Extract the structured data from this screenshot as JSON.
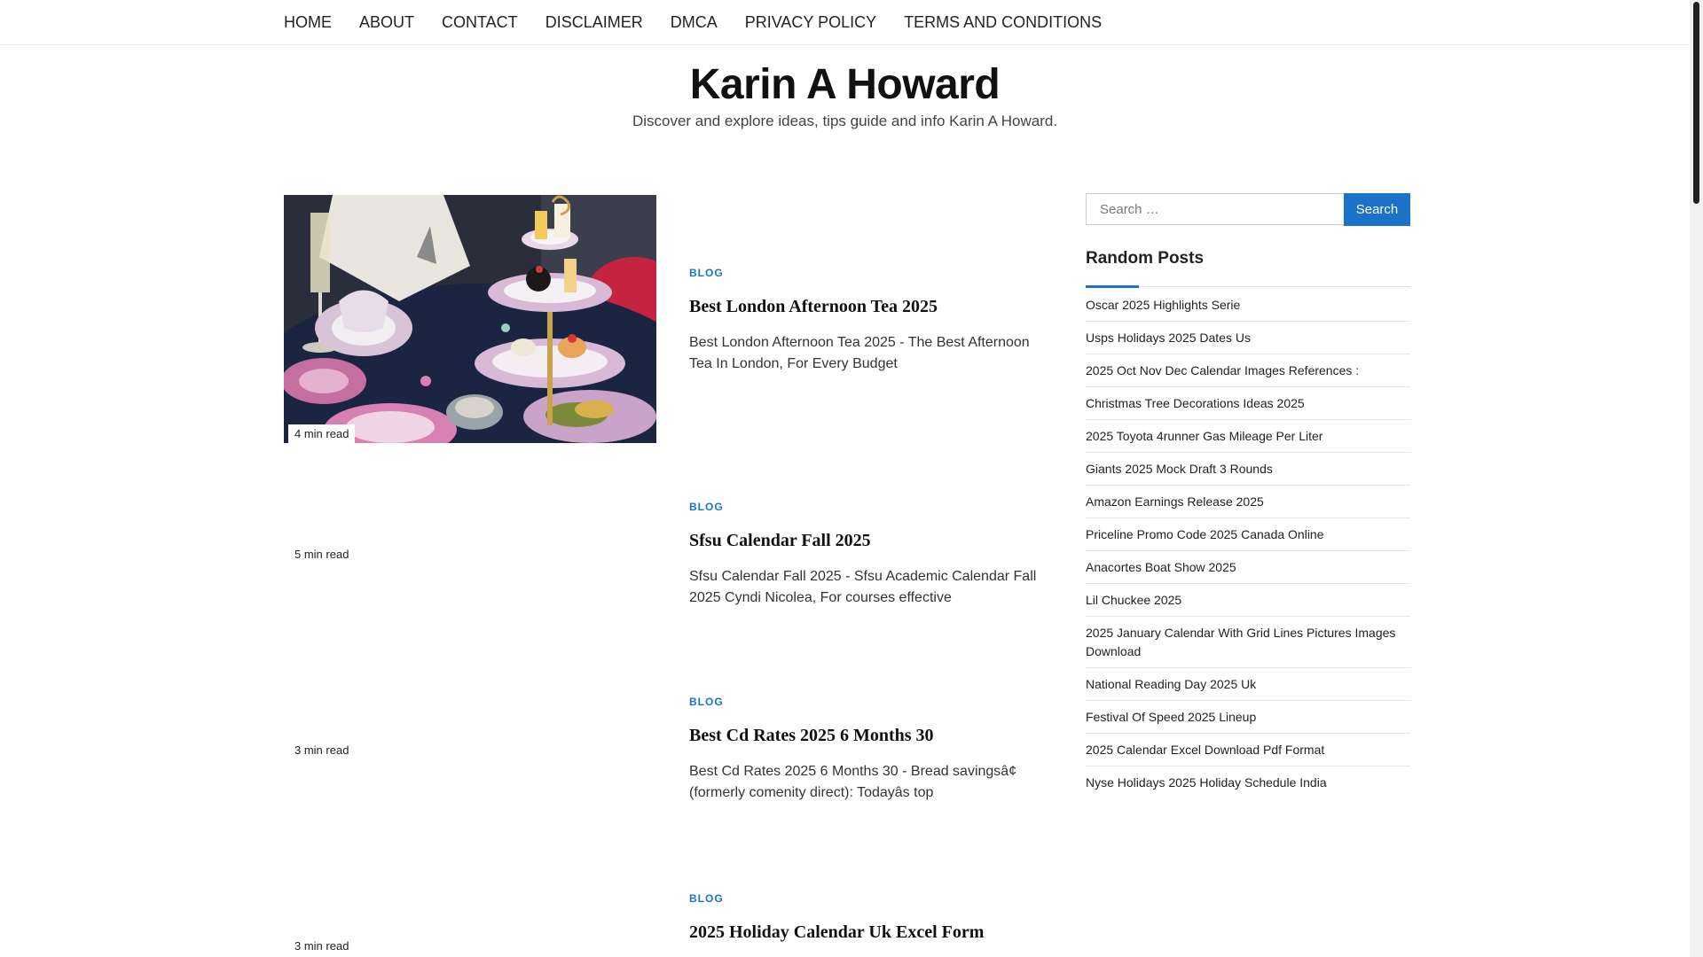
{
  "nav": {
    "items": [
      "HOME",
      "ABOUT",
      "CONTACT",
      "DISCLAIMER",
      "DMCA",
      "PRIVACY POLICY",
      "TERMS AND CONDITIONS"
    ]
  },
  "header": {
    "title": "Karin A Howard",
    "description": "Discover and explore ideas, tips guide and info Karin A Howard."
  },
  "posts": [
    {
      "category": "BLOG",
      "title": "Best London Afternoon Tea 2025",
      "excerpt": "Best London Afternoon Tea 2025 - The Best Afternoon Tea In London, For Every Budget",
      "read_time": "4 min read"
    },
    {
      "category": "BLOG",
      "title": "Sfsu Calendar Fall 2025",
      "excerpt": "Sfsu Calendar Fall 2025 - Sfsu Academic Calendar Fall 2025 Cyndi Nicolea, For courses effective",
      "read_time": "5 min read"
    },
    {
      "category": "BLOG",
      "title": "Best Cd Rates 2025 6 Months 30",
      "excerpt": "Best Cd Rates 2025 6 Months 30 - Bread savingsâ¢ (formerly comenity direct): Todayâs top",
      "read_time": "3 min read"
    },
    {
      "category": "BLOG",
      "title": "2025 Holiday Calendar Uk Excel Form",
      "excerpt": "",
      "read_time": "3 min read"
    }
  ],
  "sidebar": {
    "search": {
      "placeholder": "Search …",
      "button_label": "Search"
    },
    "random_posts": {
      "title": "Random Posts",
      "items": [
        "Oscar 2025 Highlights Serie",
        "Usps Holidays 2025 Dates Us",
        "2025 Oct Nov Dec Calendar Images References :",
        "Christmas Tree Decorations Ideas 2025",
        "2025 Toyota 4runner Gas Mileage Per Liter",
        "Giants 2025 Mock Draft 3 Rounds",
        "Amazon Earnings Release 2025",
        "Priceline Promo Code 2025 Canada Online",
        "Anacortes Boat Show 2025",
        "Lil Chuckee 2025",
        "2025 January Calendar With Grid Lines Pictures Images Download",
        "National Reading Day 2025 Uk",
        "Festival Of Speed 2025 Lineup",
        "2025 Calendar Excel Download Pdf Format",
        "Nyse Holidays 2025 Holiday Schedule India"
      ]
    }
  },
  "colors": {
    "accent": "#1a73c8",
    "text": "#222222",
    "border": "#e6e6e6"
  }
}
